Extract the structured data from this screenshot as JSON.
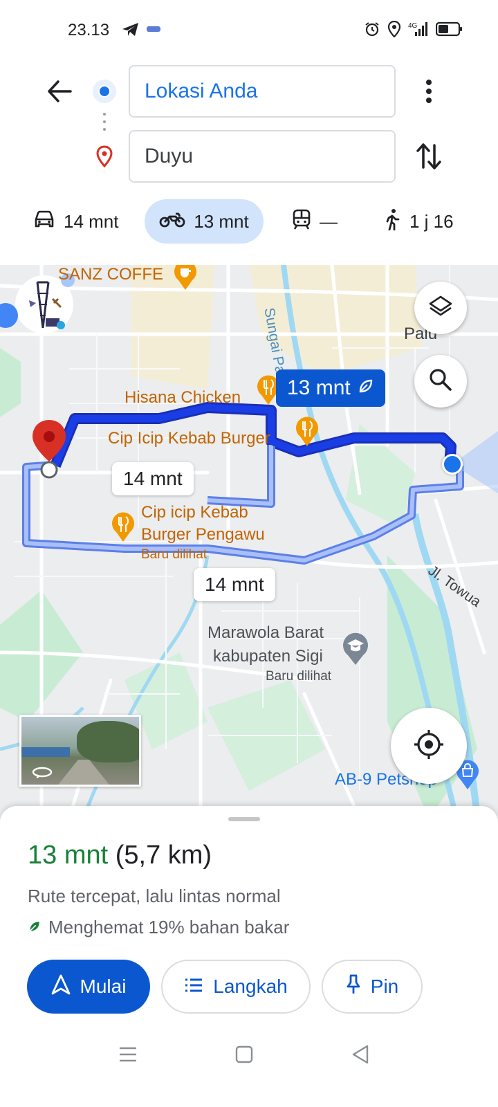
{
  "status": {
    "time": "23.13"
  },
  "search": {
    "origin": "Lokasi Anda",
    "destination": "Duyu"
  },
  "modes": [
    {
      "name": "car",
      "label": "14 mnt",
      "active": false
    },
    {
      "name": "motorcycle",
      "label": "13 mnt",
      "active": true
    },
    {
      "name": "transit",
      "label": "—",
      "active": false
    },
    {
      "name": "walk",
      "label": "1 j 16",
      "active": false
    }
  ],
  "map": {
    "labels": {
      "sanz_coffee": "SANZ COFFE",
      "sungai_palu": "Sungai Palu",
      "palu": "Palu",
      "hisana": "Hisana Chicken",
      "cip_icip_1": "Cip Icip Kebab Burger",
      "cip_icip_2_line1": "Cip icip Kebab",
      "cip_icip_2_line2": "Burger Pengawu",
      "baru_dilihat_1": "Baru dilihat",
      "marawola_line1": "Marawola Barat",
      "marawola_line2": "kabupaten Sigi",
      "baru_dilihat_2": "Baru dilihat",
      "jl_towua": "Jl. Towua",
      "petshop": "AB-9 Petshop"
    },
    "route_bubbles": {
      "active": "13 mnt",
      "alt1": "14 mnt",
      "alt2": "14 mnt"
    },
    "colors": {
      "route_active": "#1a3ee6",
      "route_alt": "#7a9cf0",
      "poi": "#c26401"
    }
  },
  "sheet": {
    "duration": "13 mnt",
    "distance": "(5,7 km)",
    "summary": "Rute tercepat, lalu lintas normal",
    "fuel": "Menghemat 19% bahan bakar",
    "buttons": {
      "start": "Mulai",
      "steps": "Langkah",
      "pin": "Pin"
    }
  }
}
